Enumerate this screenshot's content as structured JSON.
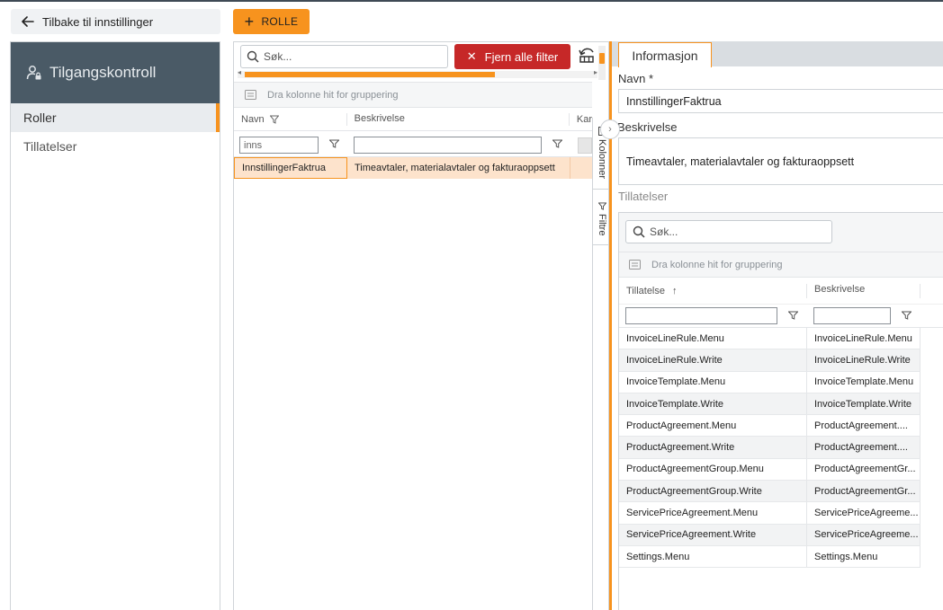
{
  "header": {
    "back_label": "Tilbake til innstillinger",
    "add_role_label": "ROLLE"
  },
  "sidebar": {
    "title": "Tilgangskontroll",
    "items": [
      {
        "label": "Roller",
        "active": true
      },
      {
        "label": "Tillatelser",
        "active": false
      }
    ]
  },
  "grid": {
    "search_placeholder": "Søk...",
    "clear_filters_label": "Fjern alle filter",
    "group_hint": "Dra kolonne hit for gruppering",
    "columns": [
      "Navn",
      "Beskrivelse",
      "Kar"
    ],
    "filter_value": "inns",
    "rows": [
      {
        "navn": "InnstillingerFaktrua",
        "beskrivelse": "Timeavtaler, materialavtaler og fakturaoppsett"
      }
    ],
    "side_tabs": [
      "Kolonner",
      "Filtre"
    ]
  },
  "detail": {
    "tab_label": "Informasjon",
    "name_label": "Navn *",
    "name_value": "InnstillingerFaktrua",
    "description_label": "Beskrivelse",
    "description_value": "Timeavtaler, materialavtaler og fakturaoppsett",
    "permissions_label": "Tillatelser",
    "permissions": {
      "search_placeholder": "Søk...",
      "group_hint": "Dra kolonne hit for gruppering",
      "columns": [
        "Tillatelse",
        "Beskrivelse"
      ],
      "sort_indicator": "↑",
      "rows": [
        {
          "tillatelse": "InvoiceLineRule.Menu",
          "beskrivelse": "InvoiceLineRule.Menu"
        },
        {
          "tillatelse": "InvoiceLineRule.Write",
          "beskrivelse": "InvoiceLineRule.Write"
        },
        {
          "tillatelse": "InvoiceTemplate.Menu",
          "beskrivelse": "InvoiceTemplate.Menu"
        },
        {
          "tillatelse": "InvoiceTemplate.Write",
          "beskrivelse": "InvoiceTemplate.Write"
        },
        {
          "tillatelse": "ProductAgreement.Menu",
          "beskrivelse": "ProductAgreement...."
        },
        {
          "tillatelse": "ProductAgreement.Write",
          "beskrivelse": "ProductAgreement...."
        },
        {
          "tillatelse": "ProductAgreementGroup.Menu",
          "beskrivelse": "ProductAgreementGr..."
        },
        {
          "tillatelse": "ProductAgreementGroup.Write",
          "beskrivelse": "ProductAgreementGr..."
        },
        {
          "tillatelse": "ServicePriceAgreement.Menu",
          "beskrivelse": "ServicePriceAgreeme..."
        },
        {
          "tillatelse": "ServicePriceAgreement.Write",
          "beskrivelse": "ServicePriceAgreeme..."
        },
        {
          "tillatelse": "Settings.Menu",
          "beskrivelse": "Settings.Menu"
        }
      ]
    }
  },
  "colors": {
    "accent": "#f7931e",
    "danger": "#c62828",
    "sidebar_header": "#4a5a66",
    "selected_row": "#fde3cc"
  }
}
